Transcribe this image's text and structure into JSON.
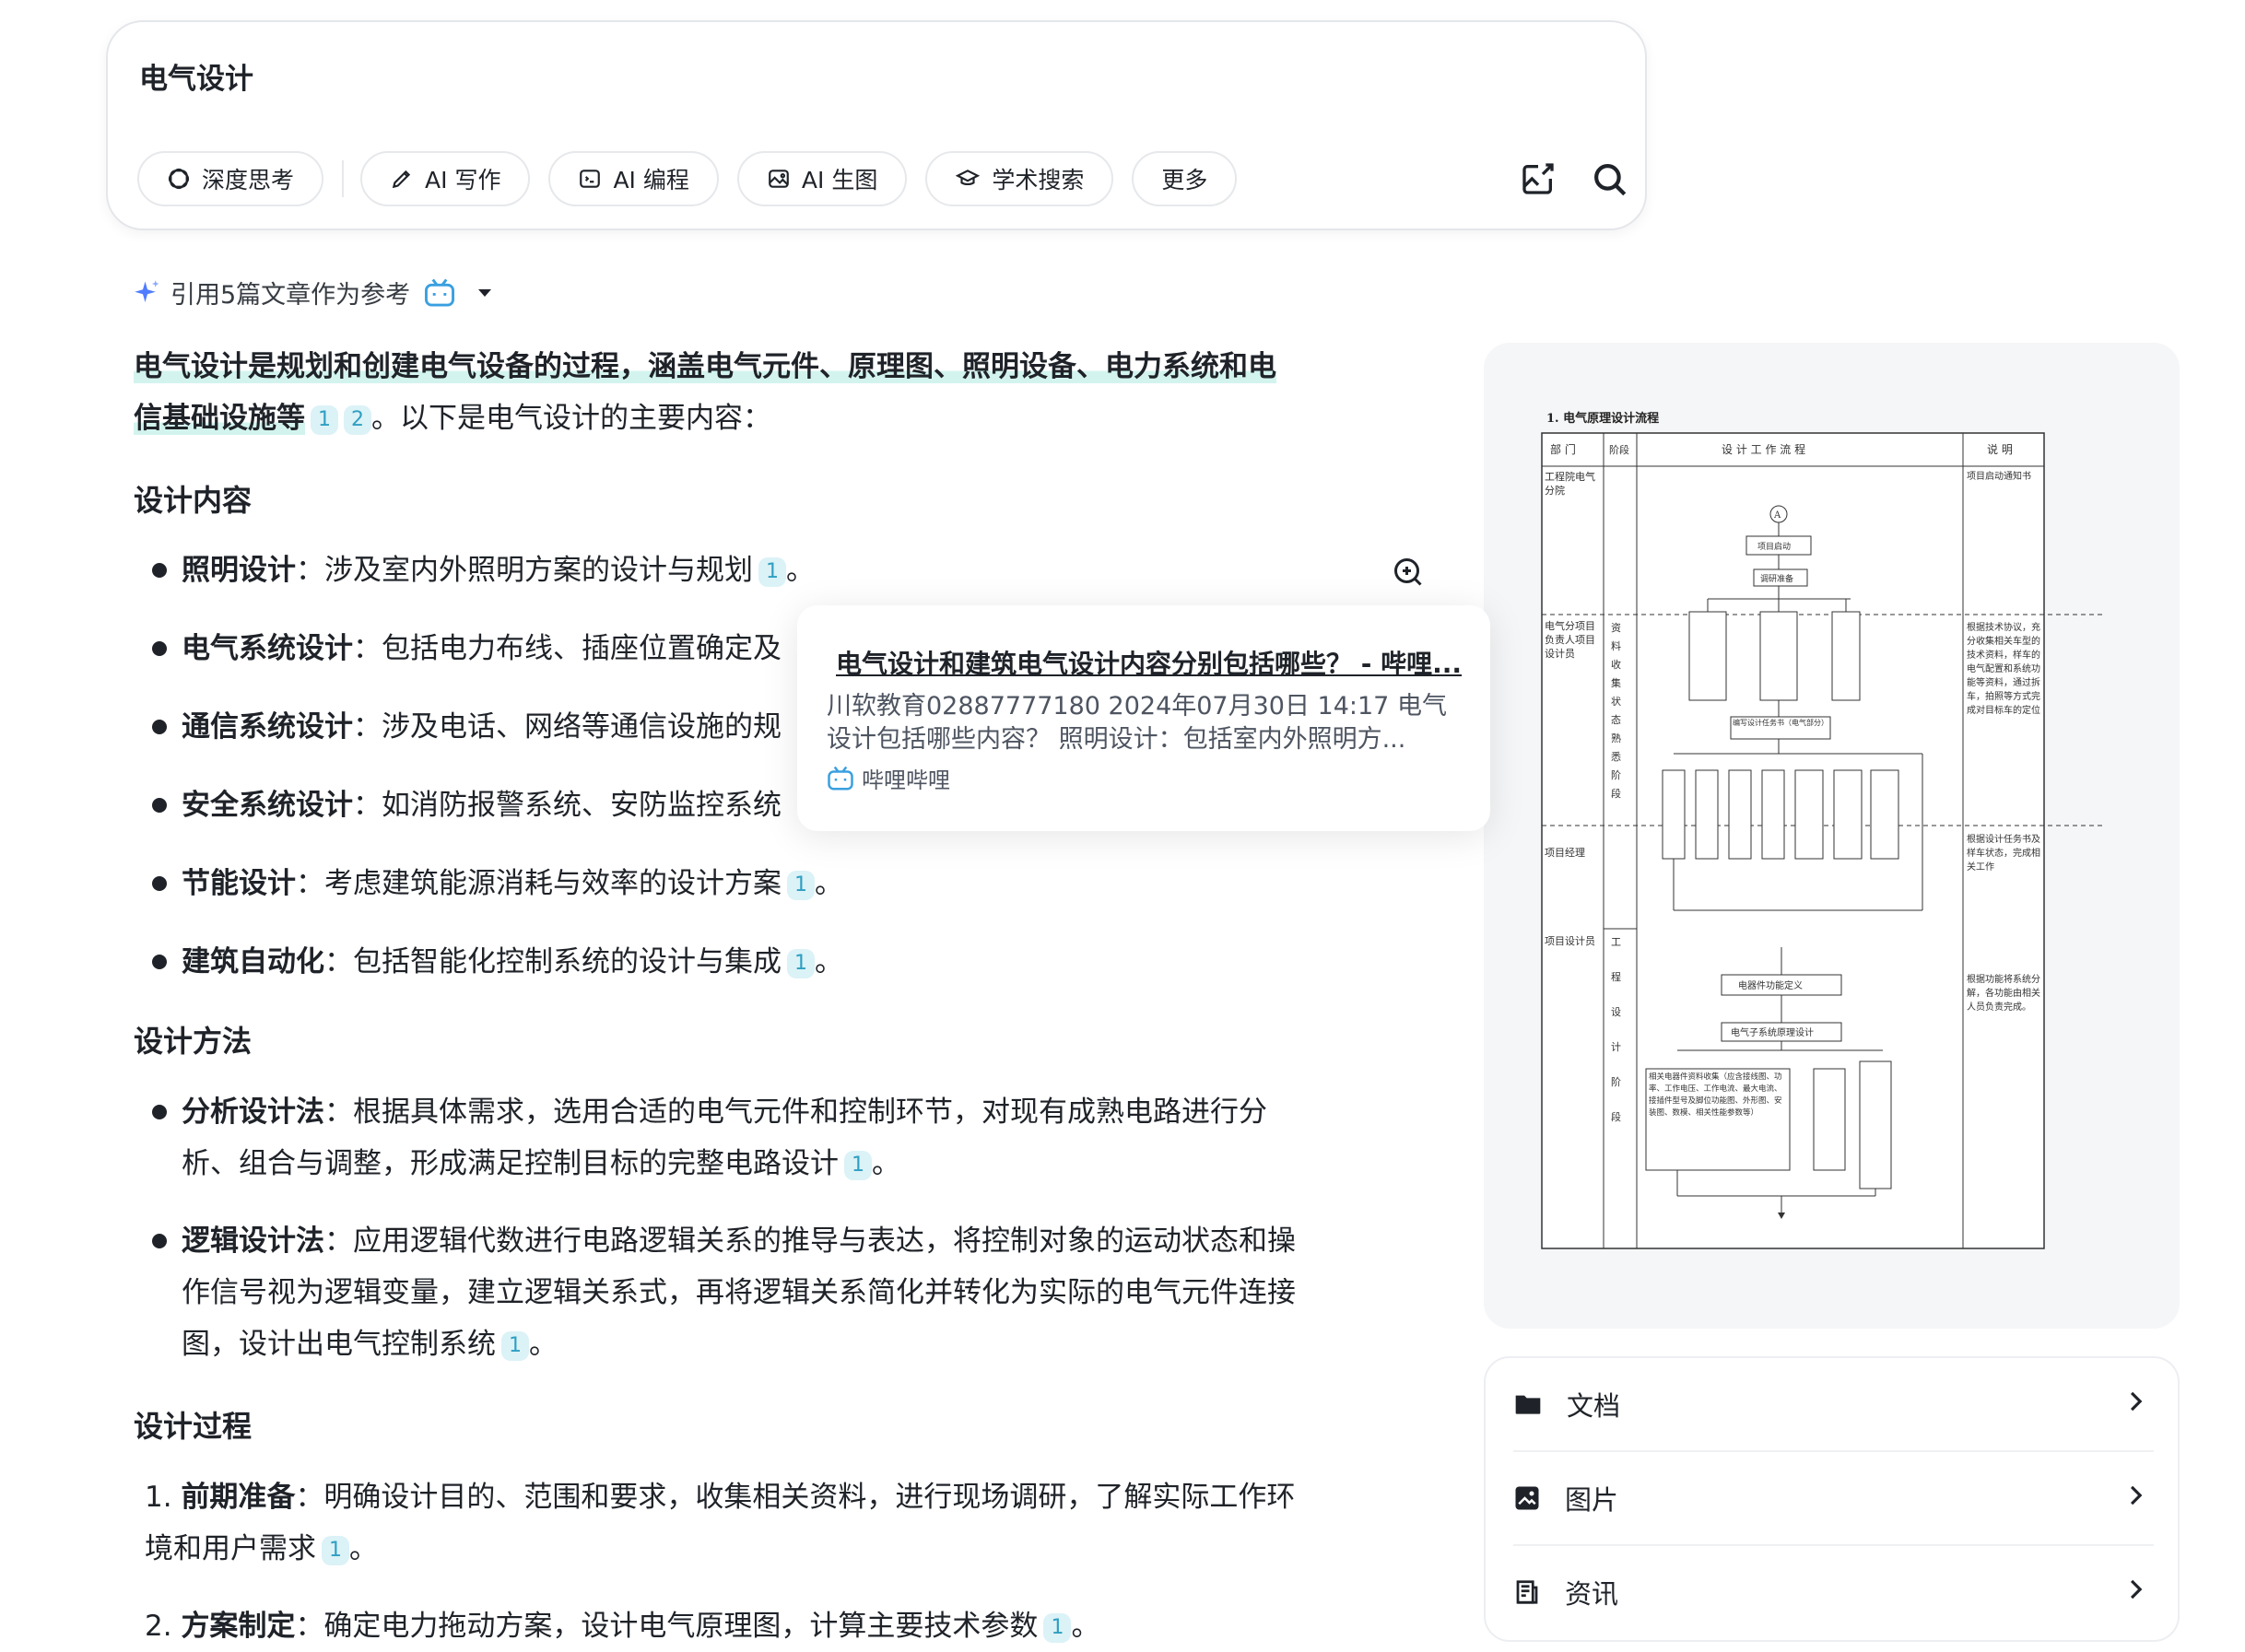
{
  "search": {
    "query": "电气设计",
    "chips": [
      "深度思考",
      "AI 写作",
      "AI 编程",
      "AI 生图",
      "学术搜索",
      "更多"
    ]
  },
  "references": {
    "label": "引用5篇文章作为参考"
  },
  "answer": {
    "intro_highlight_1": "电气设计是规划和创建电气设备的过程，涵盖电气元件、原理图、照明设备、电力系统和电",
    "intro_highlight_2": "信基础设施等",
    "intro_rest": "。以下是电气设计的主要内容：",
    "sections": {
      "content_title": "设计内容",
      "method_title": "设计方法",
      "process_title": "设计过程"
    },
    "content_items": [
      {
        "term": "照明设计",
        "text": "：涉及室内外照明方案的设计与规划"
      },
      {
        "term": "电气系统设计",
        "text": "：包括电力布线、插座位置确定及"
      },
      {
        "term": "通信系统设计",
        "text": "：涉及电话、网络等通信设施的规"
      },
      {
        "term": "安全系统设计",
        "text": "：如消防报警系统、安防监控系统"
      },
      {
        "term": "节能设计",
        "text": "：考虑建筑能源消耗与效率的设计方案"
      },
      {
        "term": "建筑自动化",
        "text": "：包括智能化控制系统的设计与集成"
      }
    ],
    "method_items": [
      {
        "term": "分析设计法",
        "line1": "：根据具体需求，选用合适的电气元件和控制环节，对现有成熟电路进行分",
        "line2": "析、组合与调整，形成满足控制目标的完整电路设计"
      },
      {
        "term": "逻辑设计法",
        "line1": "：应用逻辑代数进行电路逻辑关系的推导与表达，将控制对象的运动状态和操",
        "line2": "作信号视为逻辑变量，建立逻辑关系式，再将逻辑关系简化并转化为实际的电气元件连接",
        "line3": "图，设计出电气控制系统"
      }
    ],
    "process_items": [
      {
        "num": "1.",
        "term": "前期准备",
        "line1": "：明确设计目的、范围和要求，收集相关资料，进行现场调研，了解实际工作环",
        "line2": "境和用户需求"
      },
      {
        "num": "2.",
        "term": "方案制定",
        "line1": "：确定电力拖动方案，设计电气原理图，计算主要技术参数"
      }
    ],
    "period": "。"
  },
  "citation_card": {
    "title": "电气设计和建筑电气设计内容分别包括哪些？ - 哔哩...",
    "snippet_1": "川软教育02887777180 2024年07月30日 14:17 电气",
    "snippet_2": "设计包括哪些内容？ 照明设计：包括室内外照明方...",
    "source": "哔哩哔哩"
  },
  "diagram": {
    "title": "1. 电气原理设计流程",
    "headers": [
      "部 门",
      "阶段",
      "设 计 工 作 流 程",
      "说 明"
    ],
    "depts": [
      "工程院电气分院",
      "电气分项目负责人项目设计员",
      "项目经理",
      "项目设计员"
    ],
    "stages": [
      "资料收集状态熟悉阶段",
      "工程设计阶段"
    ],
    "notes": [
      "项目启动通知书",
      "根据技术协议，充分收集相关车型的技术资料，样车的电气配置和系统功能等资料，通过拆车，拍照等方式完成对目标车的定位",
      "根据设计任务书及样车状态，完成相关工作",
      "根据功能将系统分解，各功能由相关人员负责完成。"
    ],
    "boxes": [
      "项目启动",
      "调研准备",
      "编写设计任务书（电气部分）",
      "电器件功能定义",
      "电气子系统原理设计",
      "相关电器件资料收集（应含接线图、功率、工作电压、工作电流、最大电流、接插件型号及脚位功能图、外形图、安装图、数模、相关性能参数等）"
    ],
    "mark": "A"
  },
  "side_links": [
    "文档",
    "图片",
    "资讯"
  ],
  "cite_nums": [
    "1",
    "2"
  ]
}
